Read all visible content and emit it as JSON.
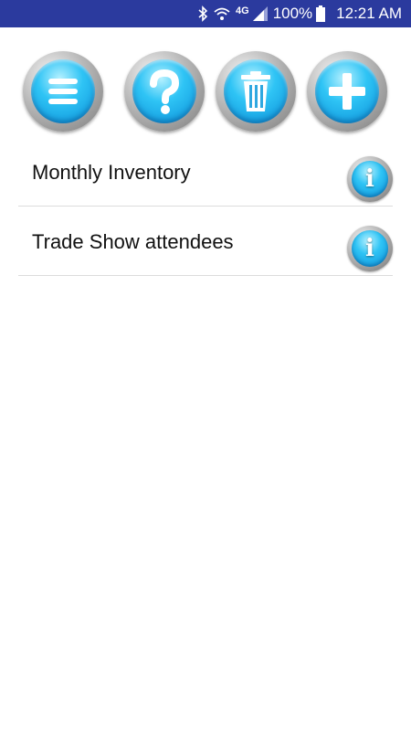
{
  "status_bar": {
    "bluetooth_icon": "bluetooth-icon",
    "wifi_icon": "wifi-icon",
    "network_label": "4G",
    "signal_icon": "signal-icon",
    "battery_percent": "100%",
    "battery_icon": "battery-icon",
    "time": "12:21 AM",
    "background_color": "#2b3a9e"
  },
  "toolbar": {
    "buttons": [
      {
        "icon": "menu-icon"
      },
      {
        "icon": "help-icon"
      },
      {
        "icon": "trash-icon"
      },
      {
        "icon": "add-icon"
      }
    ],
    "accent_color": "#2fc4f5"
  },
  "list": {
    "items": [
      {
        "label": "Monthly Inventory",
        "info_glyph": "i"
      },
      {
        "label": "Trade Show attendees",
        "info_glyph": "i"
      }
    ]
  }
}
